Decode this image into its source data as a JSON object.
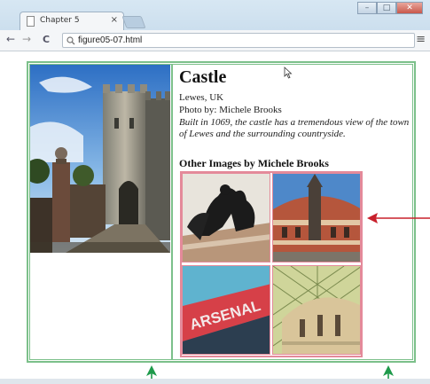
{
  "browser": {
    "tab_title": "Chapter 5",
    "tab_close": "×",
    "url": "figure05-07.html",
    "back_icon": "←",
    "forward_icon": "→",
    "reload_icon": "C",
    "search_icon": "🔍",
    "menu_icon": "≡",
    "minimize": "–",
    "maximize": "□",
    "close": "✕"
  },
  "article": {
    "title": "Castle",
    "location": "Lewes, UK",
    "photo_credit": "Photo by: Michele Brooks",
    "description": "Built in 1069, the castle has a tremendous view of the town of Lewes and the surrounding countryside."
  },
  "gallery": {
    "heading": "Other Images by Michele Brooks",
    "images": [
      "chariot-statue",
      "concert-hall",
      "arsenal-stadium",
      "glass-roof-dome"
    ]
  },
  "colors": {
    "outer_border": "#7cc08a",
    "gallery_border": "#e48a9a",
    "annotation_red": "#c8202c",
    "annotation_green": "#1f9a4b"
  }
}
